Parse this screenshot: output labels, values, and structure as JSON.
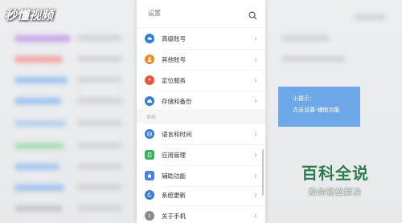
{
  "watermark": "秒懂视频",
  "header": {
    "title": "设置"
  },
  "items_top": [
    {
      "label": "高级账号",
      "icon": "cloud-account-icon",
      "color": "#2f80d6"
    },
    {
      "label": "其他账号",
      "icon": "person-icon",
      "color": "#f08a24"
    },
    {
      "label": "定位服务",
      "icon": "location-pin-icon",
      "color": "#e35a3e"
    },
    {
      "label": "存储和备份",
      "icon": "cloud-backup-icon",
      "color": "#2f80d6"
    }
  ],
  "section_label": "系统",
  "items_bottom": [
    {
      "label": "语言和时间",
      "icon": "globe-icon",
      "color": "#3a7bd5"
    },
    {
      "label": "应用管理",
      "icon": "app-manage-icon",
      "color": "#3cae5c"
    },
    {
      "label": "辅助功能",
      "icon": "hand-icon",
      "color": "#4a82d8"
    },
    {
      "label": "系统更新",
      "icon": "update-icon",
      "color": "#3a7bd5"
    },
    {
      "label": "关于手机",
      "icon": "info-icon",
      "color": "#8a8a8a"
    }
  ],
  "tip": {
    "line1": "小提示：",
    "line2": "点击设置-辅助功能"
  },
  "brand": {
    "title": "百科全说",
    "subtitle": "助你轻松解决"
  }
}
